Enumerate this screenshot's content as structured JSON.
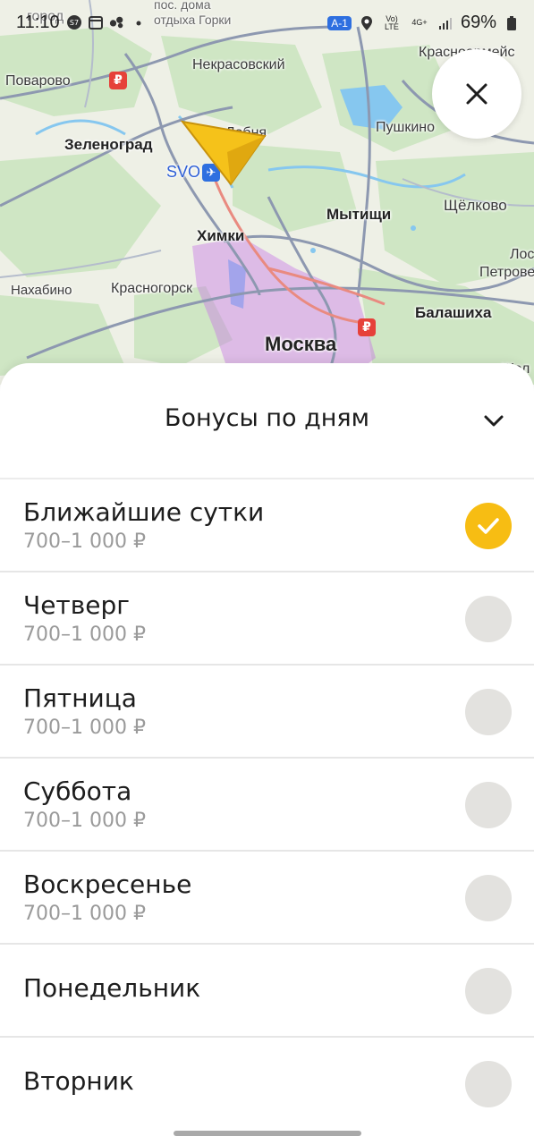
{
  "status_bar": {
    "time": "11:10",
    "battery": "69%",
    "network_badge": "A-1",
    "lte_label": "Vo) LTE",
    "net_4g_label": "4G+"
  },
  "map": {
    "labels": {
      "top_left_partial": "город",
      "poselok": "пос. дома",
      "otdykha_gorki": "отдыха Горки",
      "povarovo": "Поварово",
      "nekrasovsky": "Некрасовский",
      "krasnoarmeysk": "Красноармейс",
      "zelenograd": "Зеленоград",
      "lobnya": "Лобня",
      "pushkino": "Пушкино",
      "svo": "SVO",
      "mytishchi": "Мытищи",
      "shchyolkovo": "Щёлково",
      "khimki": "Химки",
      "los": "Лос",
      "petrovo": "Петрове",
      "nakhabino": "Нахабино",
      "krasnogorsk": "Красногорск",
      "balashikha": "Балашиха",
      "moskva": "Москва",
      "zhel": "Жел"
    },
    "ruble_symbol": "₽",
    "colors": {
      "land": "#eef0e6",
      "forest": "#cfe6c4",
      "water": "#86c7ef",
      "road": "#8d98b0",
      "traffic": "#c77ae6"
    }
  },
  "close_button": {
    "icon": "close-icon"
  },
  "sheet": {
    "title": "Бонусы по дням",
    "chevron_icon": "chevron-down-icon",
    "accent_color": "#f7bd13",
    "items": [
      {
        "label": "Ближайшие сутки",
        "sub": "700–1 000 ₽",
        "selected": true
      },
      {
        "label": "Четверг",
        "sub": "700–1 000 ₽",
        "selected": false
      },
      {
        "label": "Пятница",
        "sub": "700–1 000 ₽",
        "selected": false
      },
      {
        "label": "Суббота",
        "sub": "700–1 000 ₽",
        "selected": false
      },
      {
        "label": "Воскресенье",
        "sub": "700–1 000 ₽",
        "selected": false
      },
      {
        "label": "Понедельник",
        "sub": "",
        "selected": false
      },
      {
        "label": "Вторник",
        "sub": "",
        "selected": false
      }
    ]
  }
}
